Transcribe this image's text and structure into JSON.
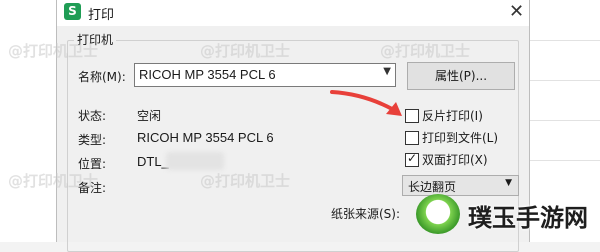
{
  "dialog": {
    "app_icon_letter": "S",
    "title": "打印",
    "close_glyph": "✕",
    "group_title": "打印机"
  },
  "printer": {
    "name_label": "名称(M):",
    "name_value": "RICOH MP 3554 PCL 6",
    "properties_label": "属性(P)...",
    "status_label": "状态:",
    "status_value": "空闲",
    "type_label": "类型:",
    "type_value": "RICOH MP 3554 PCL 6",
    "location_label": "位置:",
    "location_value": "DTL_",
    "comment_label": "备注:"
  },
  "options": {
    "reverse_label": "反片打印(I)",
    "reverse_checked": false,
    "tofile_label": "打印到文件(L)",
    "tofile_checked": false,
    "duplex_label": "双面打印(X)",
    "duplex_checked": true,
    "duplex_mode": "长边翻页",
    "paper_source_label": "纸张来源(S):"
  },
  "watermark": {
    "text": "@打印机卫士"
  },
  "overlay_logo": {
    "text": "璞玉手游网"
  },
  "colors": {
    "app_icon": "#1f9d55",
    "annotation_arrow": "#e8403a"
  }
}
